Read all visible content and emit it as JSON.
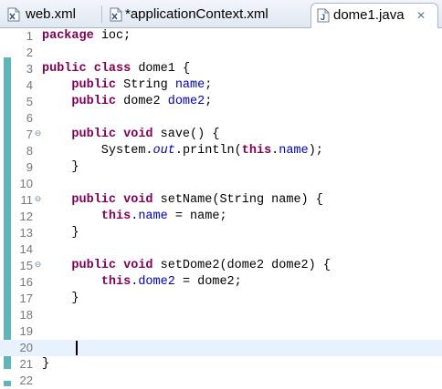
{
  "tabs": [
    {
      "label": "web.xml",
      "icon": "xml-file-icon",
      "active": false
    },
    {
      "label": "*applicationContext.xml",
      "icon": "xml-file-icon",
      "active": false
    },
    {
      "label": "dome1.java",
      "icon": "java-file-icon",
      "active": true,
      "close": "✕"
    }
  ],
  "editor": {
    "current_line": 20,
    "lines": [
      {
        "n": "1",
        "tokens": [
          [
            "kw",
            "package"
          ],
          [
            "t",
            " ioc;"
          ]
        ]
      },
      {
        "n": "2",
        "tokens": []
      },
      {
        "n": "3",
        "tokens": [
          [
            "kw",
            "public"
          ],
          [
            "t",
            " "
          ],
          [
            "kw",
            "class"
          ],
          [
            "t",
            " dome1 {"
          ]
        ]
      },
      {
        "n": "4",
        "tokens": [
          [
            "t",
            "    "
          ],
          [
            "kw",
            "public"
          ],
          [
            "t",
            " String "
          ],
          [
            "fld",
            "name"
          ],
          [
            "t",
            ";"
          ]
        ]
      },
      {
        "n": "5",
        "tokens": [
          [
            "t",
            "    "
          ],
          [
            "kw",
            "public"
          ],
          [
            "t",
            " dome2 "
          ],
          [
            "fld",
            "dome2"
          ],
          [
            "t",
            ";"
          ]
        ]
      },
      {
        "n": "6",
        "tokens": []
      },
      {
        "n": "7",
        "fold": "⊖",
        "tokens": [
          [
            "t",
            "    "
          ],
          [
            "kw",
            "public"
          ],
          [
            "t",
            " "
          ],
          [
            "kw",
            "void"
          ],
          [
            "t",
            " save() {"
          ]
        ]
      },
      {
        "n": "8",
        "tokens": [
          [
            "t",
            "        System."
          ],
          [
            "sfld",
            "out"
          ],
          [
            "t",
            ".println("
          ],
          [
            "kw",
            "this"
          ],
          [
            "t",
            "."
          ],
          [
            "fld",
            "name"
          ],
          [
            "t",
            ");"
          ]
        ]
      },
      {
        "n": "9",
        "tokens": [
          [
            "t",
            "    }"
          ]
        ]
      },
      {
        "n": "10",
        "tokens": []
      },
      {
        "n": "11",
        "fold": "⊖",
        "tokens": [
          [
            "t",
            "    "
          ],
          [
            "kw",
            "public"
          ],
          [
            "t",
            " "
          ],
          [
            "kw",
            "void"
          ],
          [
            "t",
            " setName(String name) {"
          ]
        ]
      },
      {
        "n": "12",
        "tokens": [
          [
            "t",
            "        "
          ],
          [
            "kw",
            "this"
          ],
          [
            "t",
            "."
          ],
          [
            "fld",
            "name"
          ],
          [
            "t",
            " = name;"
          ]
        ]
      },
      {
        "n": "13",
        "tokens": [
          [
            "t",
            "    }"
          ]
        ]
      },
      {
        "n": "14",
        "tokens": []
      },
      {
        "n": "15",
        "fold": "⊖",
        "tokens": [
          [
            "t",
            "    "
          ],
          [
            "kw",
            "public"
          ],
          [
            "t",
            " "
          ],
          [
            "kw",
            "void"
          ],
          [
            "t",
            " setDome2(dome2 dome2) {"
          ]
        ]
      },
      {
        "n": "16",
        "tokens": [
          [
            "t",
            "        "
          ],
          [
            "kw",
            "this"
          ],
          [
            "t",
            "."
          ],
          [
            "fld",
            "dome2"
          ],
          [
            "t",
            " = dome2;"
          ]
        ]
      },
      {
        "n": "17",
        "tokens": [
          [
            "t",
            "    }"
          ]
        ]
      },
      {
        "n": "18",
        "tokens": []
      },
      {
        "n": "19",
        "tokens": []
      },
      {
        "n": "20",
        "tokens": []
      },
      {
        "n": "21",
        "tokens": [
          [
            "t",
            "}"
          ]
        ]
      },
      {
        "n": "22",
        "tokens": []
      }
    ]
  },
  "colors": {
    "keyword": "#7f0055",
    "field": "#0000c0",
    "current_line_bg": "#e8f2fe",
    "overview_marker": "#5fb6b6"
  }
}
